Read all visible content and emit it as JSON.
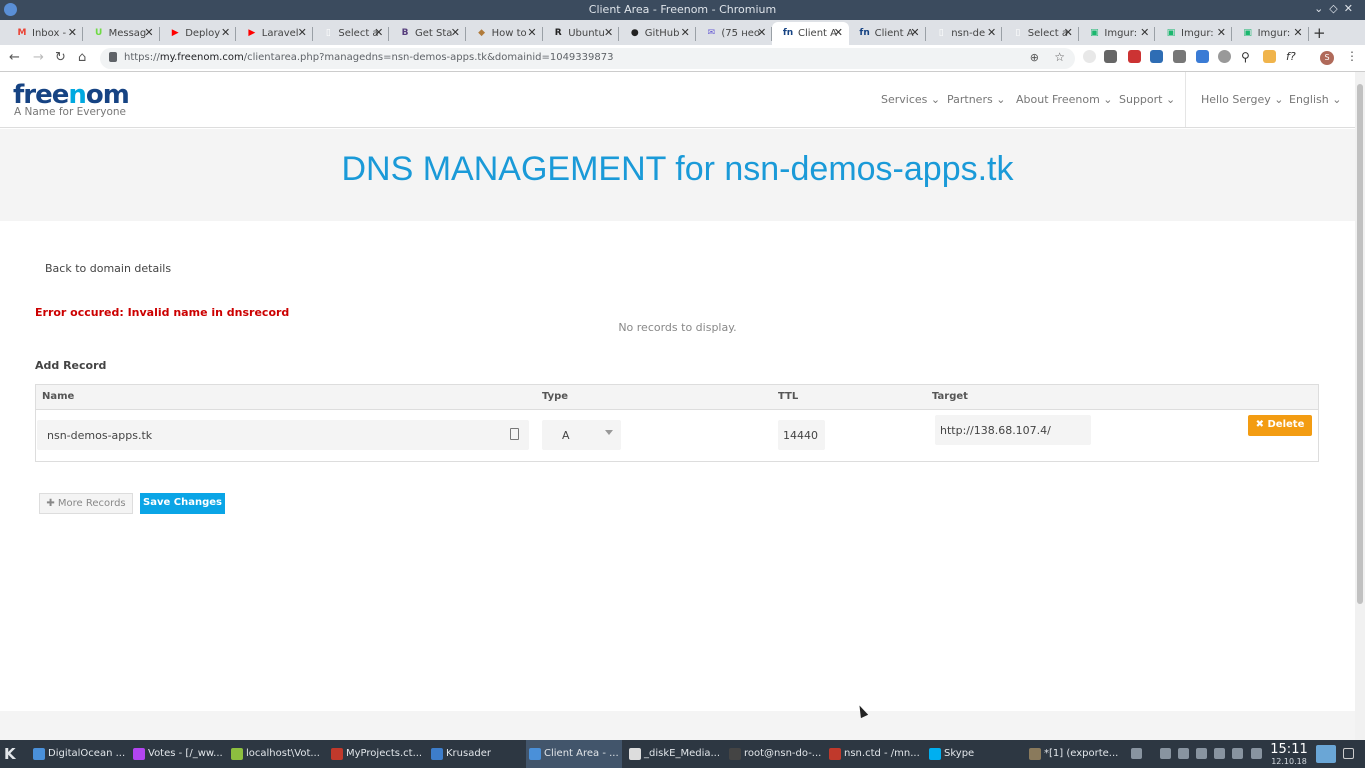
{
  "window": {
    "title": "Client Area - Freenom - Chromium"
  },
  "tabs": [
    {
      "label": "Inbox -",
      "icon": "gmail-icon",
      "color": "#ea4335",
      "glyph": "M"
    },
    {
      "label": "Messag",
      "icon": "upwork-icon",
      "color": "#6fda44",
      "glyph": "U"
    },
    {
      "label": "Deploy",
      "icon": "youtube-icon",
      "color": "#ff0000",
      "glyph": "▶"
    },
    {
      "label": "Laravel",
      "icon": "youtube-icon",
      "color": "#ff0000",
      "glyph": "▶"
    },
    {
      "label": "Select a",
      "icon": "page-icon",
      "color": "#ffffff",
      "glyph": "▯"
    },
    {
      "label": "Get Sta",
      "icon": "bootstrap-icon",
      "color": "#563d7c",
      "glyph": "B"
    },
    {
      "label": "How to",
      "icon": "cat-icon",
      "color": "#b07a3a",
      "glyph": "◆"
    },
    {
      "label": "Ubuntu",
      "icon": "r-icon",
      "color": "#222222",
      "glyph": "R"
    },
    {
      "label": "GitHub",
      "icon": "github-icon",
      "color": "#222222",
      "glyph": "●"
    },
    {
      "label": "(75 нео",
      "icon": "mail-icon",
      "color": "#6b5fd4",
      "glyph": "✉"
    },
    {
      "label": "Client A",
      "icon": "freenom-icon",
      "color": "#164383",
      "glyph": "fn",
      "active": true
    },
    {
      "label": "Client A",
      "icon": "freenom-icon",
      "color": "#164383",
      "glyph": "fn"
    },
    {
      "label": "nsn-de",
      "icon": "page-icon",
      "color": "#ffffff",
      "glyph": "▯"
    },
    {
      "label": "Select a",
      "icon": "page-icon",
      "color": "#ffffff",
      "glyph": "▯"
    },
    {
      "label": "Imgur:",
      "icon": "imgur-icon",
      "color": "#1bb76e",
      "glyph": "▣"
    },
    {
      "label": "Imgur:",
      "icon": "imgur-icon",
      "color": "#1bb76e",
      "glyph": "▣"
    },
    {
      "label": "Imgur:",
      "icon": "imgur-icon",
      "color": "#1bb76e",
      "glyph": "▣"
    }
  ],
  "address": {
    "prefix": "https://",
    "host": "my.freenom.com",
    "path": "/clientarea.php?managedns=nsn-demos-apps.tk&domainid=1049339873"
  },
  "site": {
    "logo_pre": "free",
    "logo_o": "n",
    "logo_post": "om",
    "tagline": "A Name for Everyone",
    "nav": [
      "Services",
      "Partners",
      "About Freenom",
      "Support",
      "Hello Sergey",
      "English"
    ]
  },
  "hero": {
    "title": "DNS MANAGEMENT for nsn-demos-apps.tk"
  },
  "back_link": "Back to domain details",
  "error": "Error occured: Invalid name in dnsrecord",
  "no_records": "No records to display.",
  "add_record": {
    "title": "Add Record",
    "columns": [
      "Name",
      "Type",
      "TTL",
      "Target"
    ],
    "row": {
      "name": "nsn-demos-apps.tk",
      "type": "A",
      "ttl": "14440",
      "target": "http://138.68.107.4/"
    },
    "delete_label": "✖ Delete"
  },
  "buttons": {
    "more": "✚ More Records",
    "save": "Save Changes"
  },
  "colors": {
    "accent": "#1a9ad8",
    "delete": "#f39c12",
    "save": "#0aa5e6",
    "error": "#cc0000"
  },
  "taskbar": {
    "items": [
      {
        "label": "DigitalOcean ...",
        "icon": "chromium-icon",
        "color": "#4a90d9"
      },
      {
        "label": "Votes - [/_ww...",
        "icon": "phpstorm-icon",
        "color": "#b345f1"
      },
      {
        "label": "localhost\\Vot...",
        "icon": "heidisql-icon",
        "color": "#8dbf3f"
      },
      {
        "label": "MyProjects.ct...",
        "icon": "cherrytree-icon",
        "color": "#c0392b"
      },
      {
        "label": "Krusader",
        "icon": "krusader-icon",
        "color": "#3d7dca"
      },
      {
        "label": "Client Area - ...",
        "icon": "chromium-icon",
        "color": "#4a90d9",
        "active": true
      },
      {
        "label": "_diskE_Media...",
        "icon": "obs-icon",
        "color": "#dddddd"
      },
      {
        "label": "root@nsn-do-...",
        "icon": "terminal-icon",
        "color": "#444444"
      },
      {
        "label": "nsn.ctd - /mn...",
        "icon": "cherrytree-icon",
        "color": "#c0392b"
      },
      {
        "label": "Skype",
        "icon": "skype-icon",
        "color": "#00aff0"
      },
      {
        "label": "*[1] (exporte...",
        "icon": "gimp-icon",
        "color": "#8a7a5c"
      }
    ],
    "time": "15:11",
    "date": "12.10.18"
  }
}
